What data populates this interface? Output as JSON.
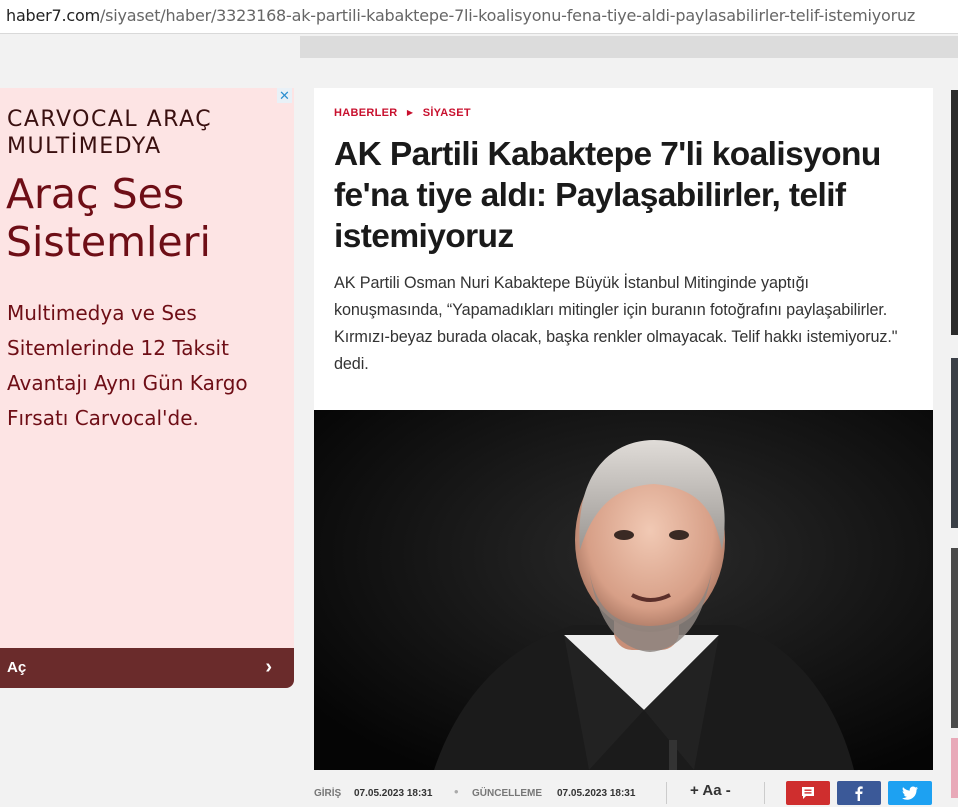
{
  "browser": {
    "url_host": "haber7.com",
    "url_path": "/siyaset/haber/3323168-ak-partili-kabaktepe-7li-koalisyonu-fena-tiye-aldi-paylasabilirler-telif-istemiyoruz"
  },
  "ad": {
    "close_icon": "close-icon",
    "brand": "CARVOCAL ARAÇ MULTİMEDYA",
    "headline": "Araç Ses Sistemleri",
    "description": "Multimedya ve Ses Sitemlerinde 12 Taksit Avantajı Aynı Gün Kargo Fırsatı Carvocal'de.",
    "cta_label": "Aç",
    "cta_icon": "chevron-right-icon",
    "colors": {
      "background": "#fde4e4",
      "text": "#6e0e16",
      "cta": "#6a2b2b"
    }
  },
  "article": {
    "breadcrumb": [
      "HABERLER",
      "SİYASET"
    ],
    "title": "AK Partili Kabaktepe 7'li koalisyonu fe'na tiye aldı: Paylaşabilirler, telif istemiyoruz",
    "summary": "AK Partili Osman Nuri Kabaktepe Büyük İstanbul Mitinginde yaptığı konuşmasında, “Yapamadıkları mitingler için buranın fotoğrafını paylaşabilirler. Kırmızı-beyaz burada olacak, başka renkler olmayacak. Telif hakkı istemiyoruz.\" dedi.",
    "accent_color": "#c8102e"
  },
  "meta": {
    "published_label": "GİRİŞ",
    "published_value": "07.05.2023 18:31",
    "updated_label": "GÜNCELLEME",
    "updated_value": "07.05.2023 18:31",
    "font_size_control": "+ Aa -",
    "share_buttons": [
      {
        "icon": "comment-icon",
        "color": "#cf2e2e"
      },
      {
        "icon": "facebook-icon",
        "color": "#3b5998"
      },
      {
        "icon": "twitter-icon",
        "color": "#1da1f2"
      }
    ]
  }
}
